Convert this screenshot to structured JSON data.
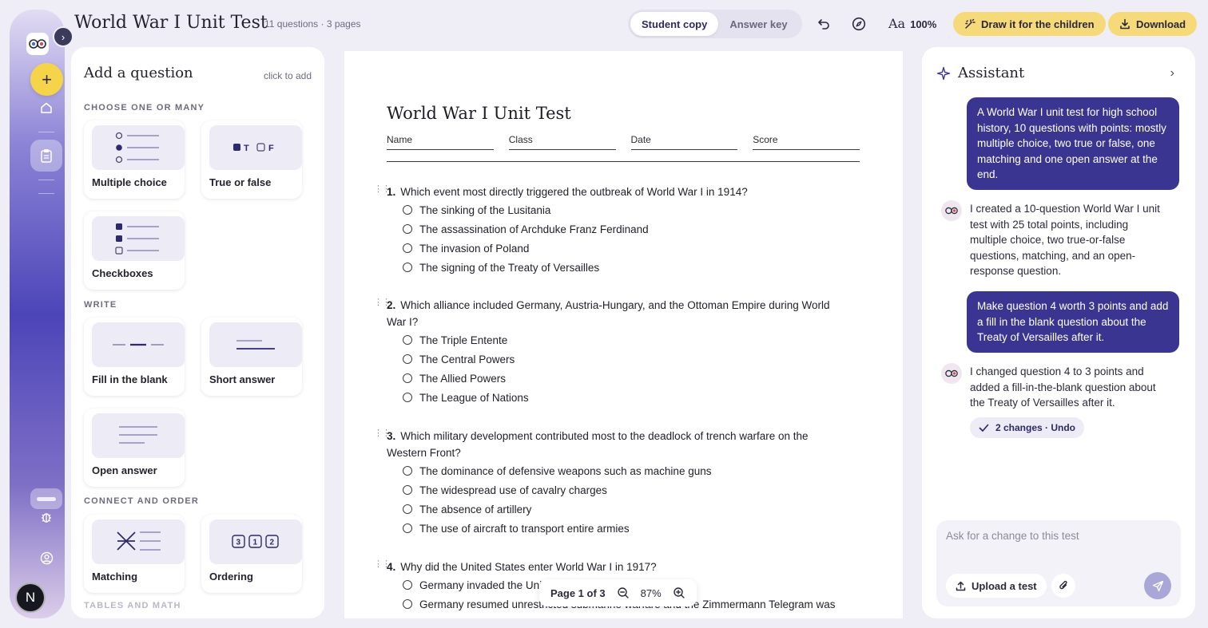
{
  "header": {
    "title": "World War I Unit Test",
    "meta": "11 questions · 3 pages",
    "tabs": [
      "Student copy",
      "Answer key"
    ],
    "active_tab": "Student copy",
    "zoom_label": "100%",
    "text_size_glyph": "Aa",
    "draw_label": "Draw it for the children",
    "download_label": "Download"
  },
  "rail": {
    "avatar_letter": "N",
    "icons": [
      "logo-icon",
      "plus-icon",
      "home-icon",
      "clipboard-icon",
      "bug-icon",
      "user-circle-icon"
    ]
  },
  "add_panel": {
    "title": "Add a question",
    "hint": "click to add",
    "sections": {
      "choose": "CHOOSE ONE OR MANY",
      "write": "WRITE",
      "connect": "CONNECT AND ORDER",
      "tables": "TABLES AND MATH"
    },
    "types": {
      "multiple_choice": "Multiple choice",
      "true_false": "True or false",
      "checkboxes": "Checkboxes",
      "fill_blank": "Fill in the blank",
      "short_answer": "Short answer",
      "open_answer": "Open answer",
      "matching": "Matching",
      "ordering": "Ordering"
    },
    "tf_glyphs": {
      "t": "T",
      "f": "F"
    },
    "ordering_glyphs": [
      "3",
      "1",
      "2"
    ]
  },
  "document": {
    "title": "World War I Unit Test",
    "fields": [
      "Name",
      "Class",
      "Date",
      "Score"
    ],
    "questions": [
      {
        "num": "1.",
        "text": "Which event most directly triggered the outbreak of World War I in 1914?",
        "options": [
          "The sinking of the Lusitania",
          "The assassination of Archduke Franz Ferdinand",
          "The invasion of Poland",
          "The signing of the Treaty of Versailles"
        ]
      },
      {
        "num": "2.",
        "text": "Which alliance included Germany, Austria-Hungary, and the Ottoman Empire during World War I?",
        "options": [
          "The Triple Entente",
          "The Central Powers",
          "The Allied Powers",
          "The League of Nations"
        ]
      },
      {
        "num": "3.",
        "text": "Which military development contributed most to the deadlock of trench warfare on the Western Front?",
        "options": [
          "The dominance of defensive weapons such as machine guns",
          "The widespread use of cavalry charges",
          "The absence of artillery",
          "The use of aircraft to transport entire armies"
        ]
      },
      {
        "num": "4.",
        "text": "Why did the United States enter World War I in 1917?",
        "options": [
          "Germany invaded the United States",
          "Germany resumed unrestricted submarine warfare and the Zimmermann Telegram was"
        ]
      }
    ],
    "pager": {
      "page_label": "Page 1 of 3",
      "zoom": "87%"
    }
  },
  "assistant": {
    "title": "Assistant",
    "messages": [
      {
        "role": "user",
        "text": "A World War I unit test for high school history, 10 questions with points: mostly multiple choice, two true or false, one matching and one open answer at the end."
      },
      {
        "role": "assistant",
        "text": "I created a 10-question World War I unit test with 25 total points, including multiple choice, two true-or-false questions, matching, and an open-response question."
      },
      {
        "role": "user",
        "text": "Make question 4 worth 3 points and add a fill in the blank question about the Treaty of Versailles after it."
      },
      {
        "role": "assistant",
        "text": "I changed question 4 to 3 points and added a fill-in-the-blank question about the Treaty of Versailles after it."
      }
    ],
    "changes_label": "2 changes · Undo",
    "composer_placeholder": "Ask for a change to this test",
    "upload_label": "Upload a test"
  },
  "colors": {
    "accent": "#3a3590",
    "yellow": "#f6d978",
    "background": "#efeef6"
  }
}
